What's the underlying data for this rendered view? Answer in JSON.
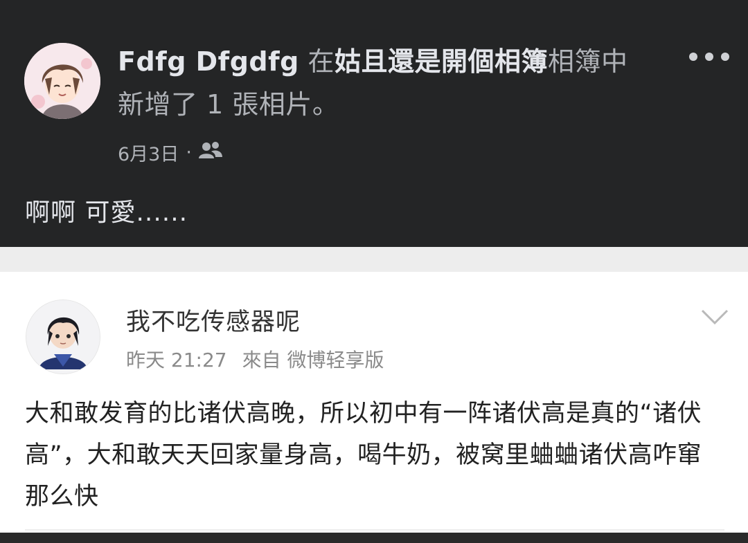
{
  "facebook_post": {
    "author": "Fdfg Dfgdfg",
    "text_in": "在",
    "album_name": "姑且還是開個相簿",
    "text_album": "相簿中",
    "text_added": "新增了 1 張相片。",
    "date": "6月3日",
    "separator": "·",
    "privacy_icon": "friends-icon",
    "more_icon": "more-horizontal-icon",
    "caption": "啊啊 可愛......"
  },
  "weibo_post": {
    "username": "我不吃传感器呢",
    "time": "昨天 21:27",
    "source": "來自 微博轻享版",
    "chevron_icon": "chevron-down-icon",
    "body": "大和敢发育的比诸伏高晚，所以初中有一阵诸伏高是真的“诸伏高”，大和敢天天回家量身高，喝牛奶，被窝里蛐蛐诸伏高咋窜那么快"
  },
  "colors": {
    "fb_background": "#242526",
    "fb_text": "#e4e6eb",
    "fb_secondary": "#b0b3b8",
    "weibo_secondary": "#8a8a8a"
  }
}
